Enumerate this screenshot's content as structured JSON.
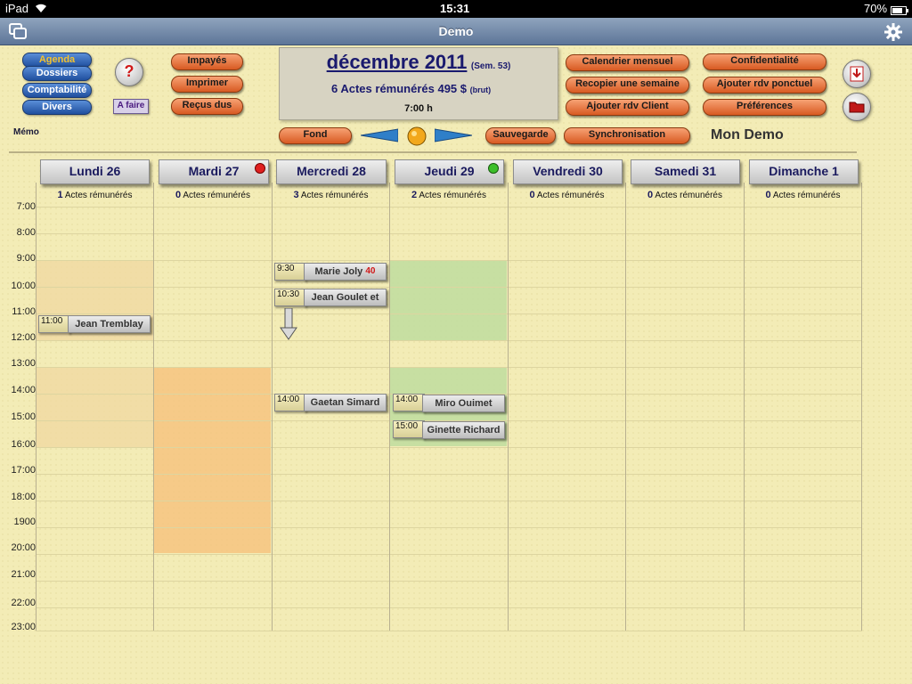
{
  "status_bar": {
    "device": "iPad",
    "time": "15:31",
    "battery": "70%"
  },
  "nav": {
    "title": "Demo"
  },
  "left_menu": [
    {
      "label": "Agenda",
      "active": true
    },
    {
      "label": "Dossiers",
      "active": false
    },
    {
      "label": "Comptabilité",
      "active": false
    },
    {
      "label": "Divers",
      "active": false
    }
  ],
  "help_symbol": "?",
  "a_faire_label": "A faire",
  "memo_label": "Mémo",
  "orange_left": [
    "Impayés",
    "Imprimer",
    "Reçus dus"
  ],
  "header": {
    "month": "décembre 2011",
    "week": "(Sem. 53)",
    "summary": "6 Actes rémunérés 495 $",
    "summary_note": "(brut)",
    "start_time": "7:00 h"
  },
  "orange_mid": [
    "Calendrier mensuel",
    "Recopier une semaine",
    "Ajouter rdv Client"
  ],
  "orange_right": [
    "Confidentialité",
    "Ajouter rdv ponctuel",
    "Préférences"
  ],
  "bottom_row": {
    "fond": "Fond",
    "sauvegarde": "Sauvegarde",
    "synchronisation": "Synchronisation"
  },
  "user_name": "Mon Demo",
  "acts_label": "Actes rémunérés",
  "days": [
    {
      "label": "Lundi  26",
      "acts": "1",
      "badge": ""
    },
    {
      "label": "Mardi  27",
      "acts": "0",
      "badge": "#e02020"
    },
    {
      "label": "Mercredi  28",
      "acts": "3",
      "badge": ""
    },
    {
      "label": "Jeudi  29",
      "acts": "2",
      "badge": "#3cbf2a"
    },
    {
      "label": "Vendredi  30",
      "acts": "0",
      "badge": ""
    },
    {
      "label": "Samedi  31",
      "acts": "0",
      "badge": ""
    },
    {
      "label": "Dimanche  1",
      "acts": "0",
      "badge": ""
    }
  ],
  "hours": [
    "7:00",
    "8:00",
    "9:00",
    "10:00",
    "11:00",
    "12:00",
    "13:00",
    "14:00",
    "15:00",
    "16:00",
    "17:00",
    "18:00",
    "1900",
    "20:00",
    "21:00",
    "22:00",
    "23:00"
  ],
  "appointments": [
    {
      "day": 2,
      "time": "9:30",
      "name": "Marie Joly",
      "extra": "40"
    },
    {
      "day": 2,
      "time": "10:30",
      "name": "Jean Goulet et",
      "extra": ""
    },
    {
      "day": 0,
      "time": "11:00",
      "name": "Jean Tremblay",
      "extra": ""
    },
    {
      "day": 2,
      "time": "14:00",
      "name": "Gaetan Simard",
      "extra": ""
    },
    {
      "day": 3,
      "time": "14:00",
      "name": "Miro Ouimet",
      "extra": ""
    },
    {
      "day": 3,
      "time": "15:00",
      "name": "Ginette Richard",
      "extra": ""
    }
  ],
  "colors": {
    "accent_orange": "#d85a22",
    "accent_blue": "#1f4f9e",
    "background": "#f3ecb6"
  }
}
